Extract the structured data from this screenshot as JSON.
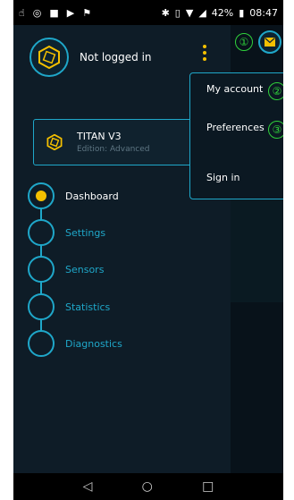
{
  "status_bar": {
    "battery_percent": "42%",
    "time": "08:47"
  },
  "user": {
    "label": "Not logged in"
  },
  "device": {
    "name": "TITAN V3",
    "edition": "Edition: Advanced"
  },
  "nav": {
    "items": [
      {
        "label": "Dashboard",
        "active": true
      },
      {
        "label": "Settings",
        "active": false
      },
      {
        "label": "Sensors",
        "active": false
      },
      {
        "label": "Statistics",
        "active": false
      },
      {
        "label": "Diagnostics",
        "active": false
      }
    ]
  },
  "menu": {
    "items": [
      {
        "label": "My account"
      },
      {
        "label": "Preferences"
      },
      {
        "label": "Sign in"
      }
    ]
  },
  "annotations": {
    "one": "①",
    "two": "②",
    "three": "③"
  },
  "colors": {
    "accent": "#1fa7c9",
    "active_dot": "#f5c000",
    "annotation": "#2fd13b",
    "background": "#0e1c27"
  }
}
